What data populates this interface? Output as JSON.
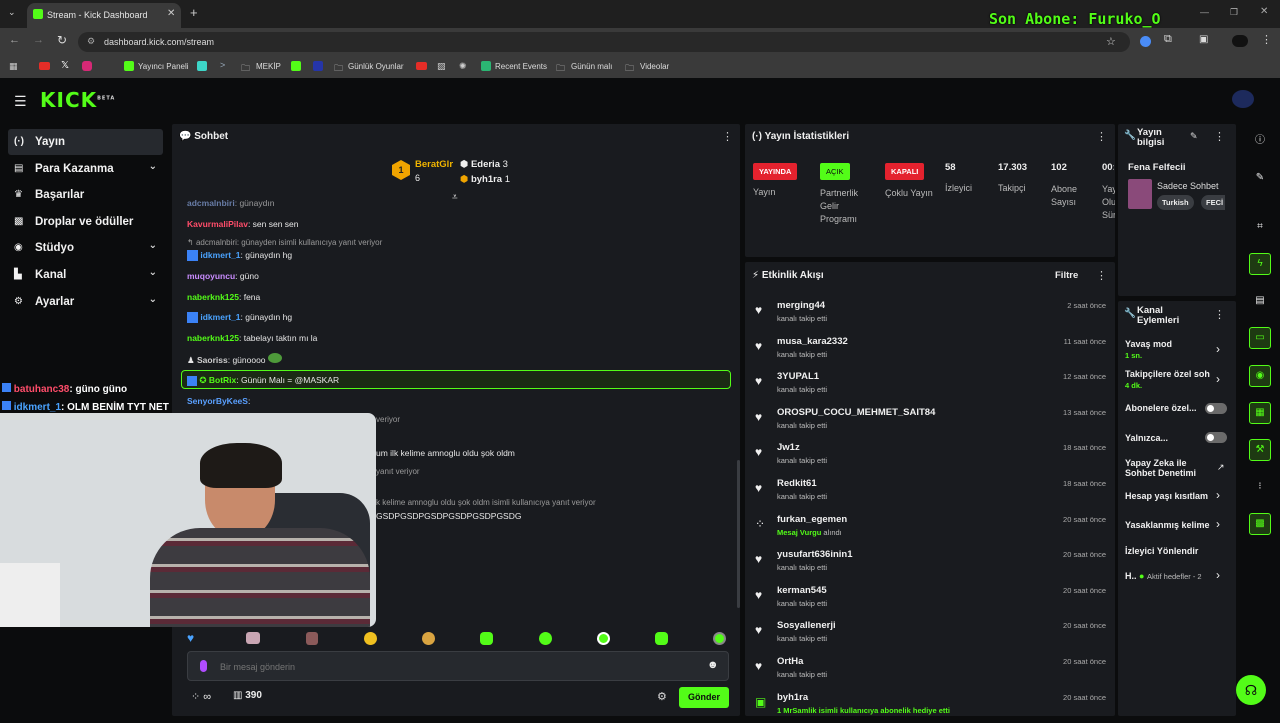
{
  "browser": {
    "tab_title": "Stream - Kick Dashboard",
    "url": "dashboard.kick.com/stream",
    "bookmarks": [
      "Yayıncı Paneli",
      "MEKİP",
      "Günlük Oyunlar",
      "Recent Events",
      "Günün malı",
      "Videolar"
    ]
  },
  "overlay": {
    "last_sub": "Son Abone: Furuko_O",
    "chat_overlay": [
      {
        "user": "batuhanc38",
        "text": ": güno güno"
      },
      {
        "user": "idkmert_1",
        "text": ": OLM BENİM TYT NET DÜŞMÜŞ"
      }
    ]
  },
  "sidebar": {
    "items": [
      {
        "label": "Yayın",
        "icon": "broadcast-icon",
        "active": true
      },
      {
        "label": "Para Kazanma",
        "icon": "money-icon"
      },
      {
        "label": "Başarılar",
        "icon": "trophy-icon"
      },
      {
        "label": "Droplar ve ödüller",
        "icon": "gift-icon"
      },
      {
        "label": "Stüdyo",
        "icon": "studio-icon"
      },
      {
        "label": "Kanal",
        "icon": "channel-icon"
      },
      {
        "label": "Ayarlar",
        "icon": "gear-icon"
      }
    ]
  },
  "chat": {
    "title": "Sohbet",
    "top": [
      {
        "rank": "1",
        "name": "BeratGlr",
        "count": "6"
      },
      {
        "name": "Ederia",
        "count": "3"
      },
      {
        "name": "byh1ra",
        "count": "1"
      }
    ],
    "messages": [
      {
        "user": "adcmalnbiri",
        "text": ": günaydın",
        "color": "#9bbcff"
      },
      {
        "user": "KavurmaliPilav",
        "text": ": sen sen sen",
        "color": "#ff4d6a"
      },
      {
        "reply": "adcmalnbiri: günayden isimli kullanıcıya yanıt veriyor"
      },
      {
        "user": "idkmert_1",
        "text": ": günaydın hg",
        "color": "#4aa3ff"
      },
      {
        "user": "muqoyuncu",
        "text": ": güno",
        "color": "#c98cff"
      },
      {
        "user": "naberknk125",
        "text": ": fena",
        "color": "#53fc18"
      },
      {
        "user": "idkmert_1",
        "text": ": günaydın hg",
        "color": "#4aa3ff"
      },
      {
        "user": "naberknk125",
        "text": ": tabelayı taktın mı la",
        "color": "#53fc18"
      },
      {
        "user": "Saoriss",
        "text": ": günoooo",
        "color": "#cfcfcf"
      },
      {
        "user": "BotRix",
        "text": ": Günün Malı = @MASKAR",
        "color": "#53fc18"
      },
      {
        "user": "SenyorByKeeS",
        "text": ":",
        "color": "#5aa0ff"
      },
      {
        "text": "veriyor"
      },
      {
        "text": "um ilk kelime amnoglu oldu şok oldm"
      },
      {
        "text": "yanıt veriyor"
      },
      {
        "text": "k kelime amnoglu oldu şok oldm isimli kullanıcıya yanıt veriyor"
      },
      {
        "text": "GSDPGSDPGSDPGSDPGSDPGSDG"
      }
    ],
    "input_placeholder": "Bir mesaj gönderin",
    "points": "390",
    "infinity": "∞",
    "send_label": "Gönder"
  },
  "stats": {
    "title": "Yayın İstatistikleri",
    "badges": [
      {
        "label": "YAYINDA",
        "caption": "Yayın",
        "color": "#e4222e"
      },
      {
        "label": "AÇIK",
        "caption": "Partnerlik Gelir Programı",
        "color": "#53fc18"
      },
      {
        "label": "KAPALI",
        "caption": "Çoklu Yayın",
        "color": "#e4222e"
      }
    ],
    "numbers": [
      {
        "value": "58",
        "caption": "İzleyici"
      },
      {
        "value": "17.303",
        "caption": "Takipçi"
      },
      {
        "value": "102",
        "caption": "Abone Sayısı"
      },
      {
        "value": "00:",
        "caption": "Yay Olu Süre"
      }
    ]
  },
  "stream_info": {
    "title": "Yayın bilgisi",
    "stream_title": "Fena Felfecii",
    "category": "Sadece Sohbet",
    "tags": [
      "Turkish",
      "FECİ"
    ]
  },
  "activity": {
    "title": "Etkinlik Akışı",
    "filter": "Filtre",
    "items": [
      {
        "name": "merging44",
        "sub": "kanalı takip etti",
        "time": "2 saat önce",
        "icon": "heart-icon"
      },
      {
        "name": "musa_kara2332",
        "sub": "kanalı takip etti",
        "time": "11 saat önce",
        "icon": "heart-icon"
      },
      {
        "name": "3YUPAL1",
        "sub": "kanalı takip etti",
        "time": "12 saat önce",
        "icon": "heart-icon"
      },
      {
        "name": "OROSPU_COCU_MEHMET_SAIT84",
        "sub": "kanalı takip etti",
        "time": "13 saat önce",
        "icon": "heart-icon"
      },
      {
        "name": "Jw1z",
        "sub": "kanalı takip etti",
        "time": "18 saat önce",
        "icon": "heart-icon"
      },
      {
        "name": "Redkit61",
        "sub": "kanalı takip etti",
        "time": "18 saat önce",
        "icon": "heart-icon"
      },
      {
        "name": "furkan_egemen",
        "sub": "Mesaj Vurgu",
        "sub2": " alındı",
        "time": "20 saat önce",
        "icon": "points-icon"
      },
      {
        "name": "yusufart636inin1",
        "sub": "kanalı takip etti",
        "time": "20 saat önce",
        "icon": "heart-icon"
      },
      {
        "name": "kerman545",
        "sub": "kanalı takip etti",
        "time": "20 saat önce",
        "icon": "heart-icon"
      },
      {
        "name": "Sosyallenerji",
        "sub": "kanalı takip etti",
        "time": "20 saat önce",
        "icon": "heart-icon"
      },
      {
        "name": "OrtHa",
        "sub": "kanalı takip etti",
        "time": "20 saat önce",
        "icon": "heart-icon"
      },
      {
        "name": "byh1ra",
        "sub": "1 MrSamlik isimli kullanıcıya abonelik hediye etti",
        "time": "20 saat önce",
        "icon": "gift-icon"
      }
    ]
  },
  "channel_actions": {
    "title": "Kanal Eylemleri",
    "items": [
      {
        "label": "Yavaş mod",
        "sub": "1 sn."
      },
      {
        "label": "Takipçilere özel soh",
        "sub": "4 dk."
      },
      {
        "label": "Abonelere özel..."
      },
      {
        "label": "Yalnızca..."
      },
      {
        "label": "Yapay Zeka ile Sohbet Denetimi"
      },
      {
        "label": "Hesap yaşı kısıtlam"
      },
      {
        "label": "Yasaklanmış kelime"
      },
      {
        "label": "İzleyici Yönlendir"
      },
      {
        "label": "H..",
        "sub": "Aktif hedefler - 2"
      }
    ]
  },
  "colors": {
    "accent": "#53fc18",
    "live": "#e4222e",
    "panel": "#191b1f"
  }
}
